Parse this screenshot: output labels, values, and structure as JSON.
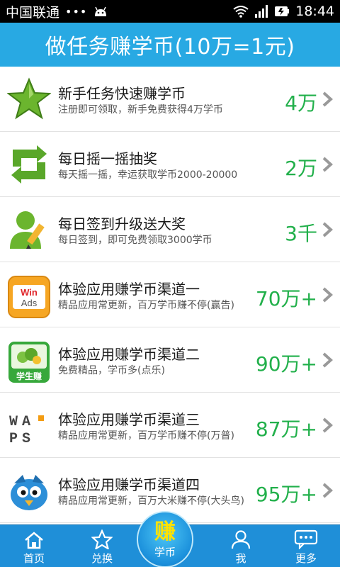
{
  "status_bar": {
    "carrier": "中国联通",
    "dots": "•••",
    "time": "18:44"
  },
  "header": {
    "title": "做任务赚学币(10万=1元)"
  },
  "tasks": [
    {
      "title": "新手任务快速赚学币",
      "desc": "注册即可领取，新手免费获得4万学币",
      "reward": "4万",
      "icon": "green-star-icon"
    },
    {
      "title": "每日摇一摇抽奖",
      "desc": "每天摇一摇，幸运获取学币2000-20000",
      "reward": "2万",
      "icon": "green-refresh-icon"
    },
    {
      "title": "每日签到升级送大奖",
      "desc": "每日签到，即可免费领取3000学币",
      "reward": "3千",
      "icon": "user-pencil-icon"
    },
    {
      "title": "体验应用赚学币渠道一",
      "desc": "精品应用常更新，百万学币赚不停(赢告)",
      "reward": "70万+",
      "icon": "winads-logo-icon",
      "logo_line1": "Win",
      "logo_line2": "Ads"
    },
    {
      "title": "体验应用赚学币渠道二",
      "desc": "免费精品，学币多(点乐)",
      "reward": "90万+",
      "icon": "student-earn-logo-icon",
      "logo_text": "学生赚"
    },
    {
      "title": "体验应用赚学币渠道三",
      "desc": "精品应用常更新，百万学币赚不停(万普)",
      "reward": "87万+",
      "icon": "waps-logo-icon",
      "logo_line1": "WA",
      "logo_line2": "PS"
    },
    {
      "title": "体验应用赚学币渠道四",
      "desc": "精品应用常更新，百万大米赚不停(大头鸟)",
      "reward": "95万+",
      "icon": "bird-logo-icon"
    }
  ],
  "tab_bar": {
    "tabs": [
      {
        "label": "首页",
        "icon": "home-icon"
      },
      {
        "label": "兑换",
        "icon": "star-outline-icon"
      },
      {
        "label": "学币",
        "glyph": "赚",
        "icon": "earn-icon"
      },
      {
        "label": "我",
        "icon": "person-icon"
      },
      {
        "label": "更多",
        "icon": "chat-more-icon"
      }
    ]
  },
  "colors": {
    "header": "#28a9e3",
    "reward": "#22b04b",
    "tab_bar": "#1f8fd8",
    "center_glyph": "#ffe200"
  }
}
